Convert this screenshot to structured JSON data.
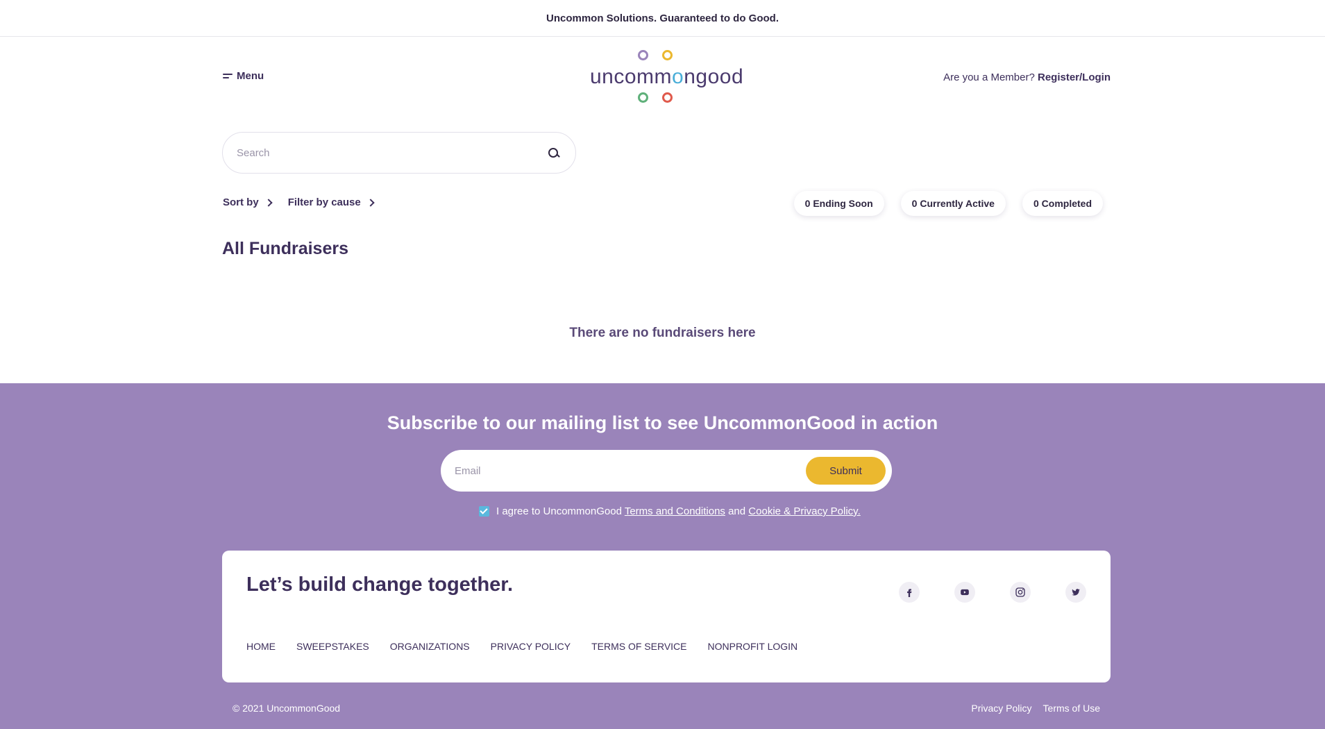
{
  "topbar": {
    "text": "Uncommon Solutions. Guaranteed to do Good."
  },
  "header": {
    "menu_label": "Menu",
    "logo_text_a": "uncomm",
    "logo_text_b": "o",
    "logo_text_c": "ngood",
    "member_prompt": "Are you a Member?",
    "login_link": "Register/Login"
  },
  "logo_colors": {
    "purple": "#9a84ba",
    "yellow": "#ebb82f",
    "green": "#5fb07a",
    "red": "#e05a4c",
    "blue": "#4aaed8"
  },
  "search": {
    "placeholder": "Search"
  },
  "controls": {
    "sort_label": "Sort by",
    "filter_label": "Filter by cause"
  },
  "status_pills": [
    {
      "label": "0 Ending Soon"
    },
    {
      "label": "0 Currently Active"
    },
    {
      "label": "0 Completed"
    }
  ],
  "main": {
    "title": "All Fundraisers",
    "empty_message": "There are no fundraisers here"
  },
  "subscribe": {
    "title": "Subscribe to our mailing list to see UncommonGood in action",
    "email_placeholder": "Email",
    "submit_label": "Submit",
    "agree_text": "I agree to UncommonGood",
    "terms_link": "Terms and Conditions",
    "and_text": "and",
    "privacy_link": "Cookie & Privacy Policy.",
    "checked": true
  },
  "footer_card": {
    "tagline": "Let’s build change together.",
    "socials": [
      "facebook-icon",
      "youtube-icon",
      "instagram-icon",
      "twitter-icon"
    ],
    "links": [
      "HOME",
      "SWEEPSTAKES",
      "ORGANIZATIONS",
      "PRIVACY POLICY",
      "TERMS OF SERVICE",
      "NONPROFIT LOGIN"
    ]
  },
  "bottom": {
    "copyright": "© 2021 UncommonGood",
    "privacy": "Privacy Policy",
    "terms": "Terms of Use"
  },
  "colors": {
    "footer_bg": "#9a84ba",
    "accent_yellow": "#ebb82f",
    "text_dark": "#3d2f5b"
  }
}
